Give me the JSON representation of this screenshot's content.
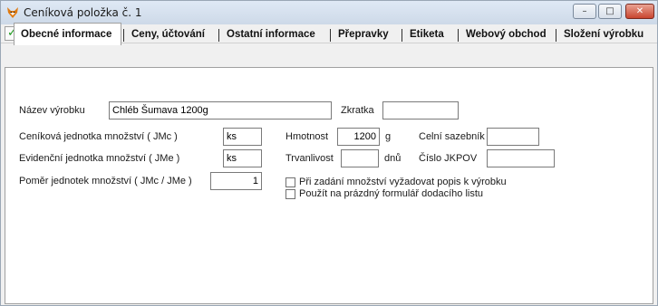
{
  "window": {
    "title": "Ceníková položka č. 1",
    "minimize_glyph": "–",
    "maximize_glyph": "□",
    "close_glyph": "✕"
  },
  "toolbar": {
    "ok_icon": "✓",
    "cancel_icon": "✕"
  },
  "tabs": [
    {
      "label": "Obecné informace"
    },
    {
      "label": "Ceny, účtování"
    },
    {
      "label": "Ostatní informace"
    },
    {
      "label": "Přepravky"
    },
    {
      "label": "Etiketa"
    },
    {
      "label": "Webový obchod"
    },
    {
      "label": "Složení výrobku"
    }
  ],
  "form": {
    "nazev_label": "Název výrobku",
    "nazev_value": "Chléb Šumava 1200g",
    "zkratka_label": "Zkratka",
    "zkratka_value": "",
    "cenikova_label": "Ceníková jednotka množství ( JMc )",
    "cenikova_value": "ks",
    "evidencni_label": "Evidenční jednotka množství ( JMe )",
    "evidencni_value": "ks",
    "pomer_label": "Poměr jednotek množství ( JMc / JMe )",
    "pomer_value": "1",
    "hmotnost_label": "Hmotnost",
    "hmotnost_value": "1200",
    "hmotnost_unit": "g",
    "trvanlivost_label": "Trvanlivost",
    "trvanlivost_value": "",
    "trvanlivost_unit": "dnů",
    "celni_label": "Celní sazebník",
    "celni_value": "",
    "jkpov_label": "Číslo JKPOV",
    "jkpov_value": "",
    "chk_popis_label": "Při zadání množství vyžadovat popis k výrobku",
    "chk_popis_checked": false,
    "chk_formular_label": "Použít na prázdný formulář dodacího listu",
    "chk_formular_checked": false
  },
  "colors": {
    "ok": "#1e9a1e",
    "cancel": "#c81e1e",
    "close_button": "#c9452f"
  }
}
